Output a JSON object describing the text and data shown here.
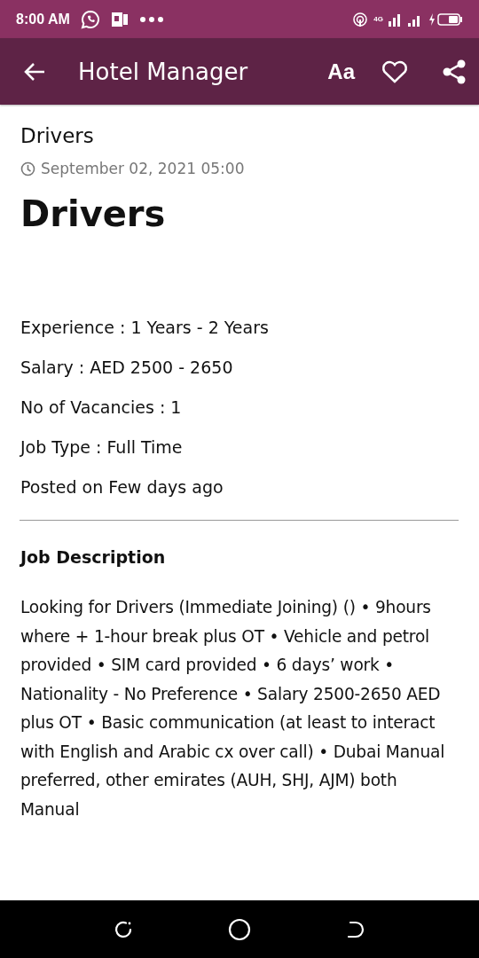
{
  "status_bar": {
    "time": "8:00 AM",
    "network": "4G"
  },
  "app_bar": {
    "title": "Hotel Manager",
    "font_button": "Aa"
  },
  "article": {
    "category": "Drivers",
    "date": "September 02, 2021 05:00",
    "title": "Drivers",
    "details": [
      "Experience : 1 Years - 2 Years",
      "Salary : AED 2500 - 2650",
      "No of Vacancies : 1",
      "Job Type : Full Time",
      "Posted on Few days ago"
    ],
    "section_heading": "Job Description",
    "description": "Looking for Drivers (Immediate Joining) () • 9hours where + 1-hour break plus OT • Vehicle and petrol provided • SIM card provided • 6 days’ work • Nationality - No Preference • Salary 2500-2650 AED plus OT • Basic communication (at least to interact with English and Arabic cx over call) • Dubai Manual preferred, other emirates (AUH, SHJ, AJM) both Manual"
  }
}
